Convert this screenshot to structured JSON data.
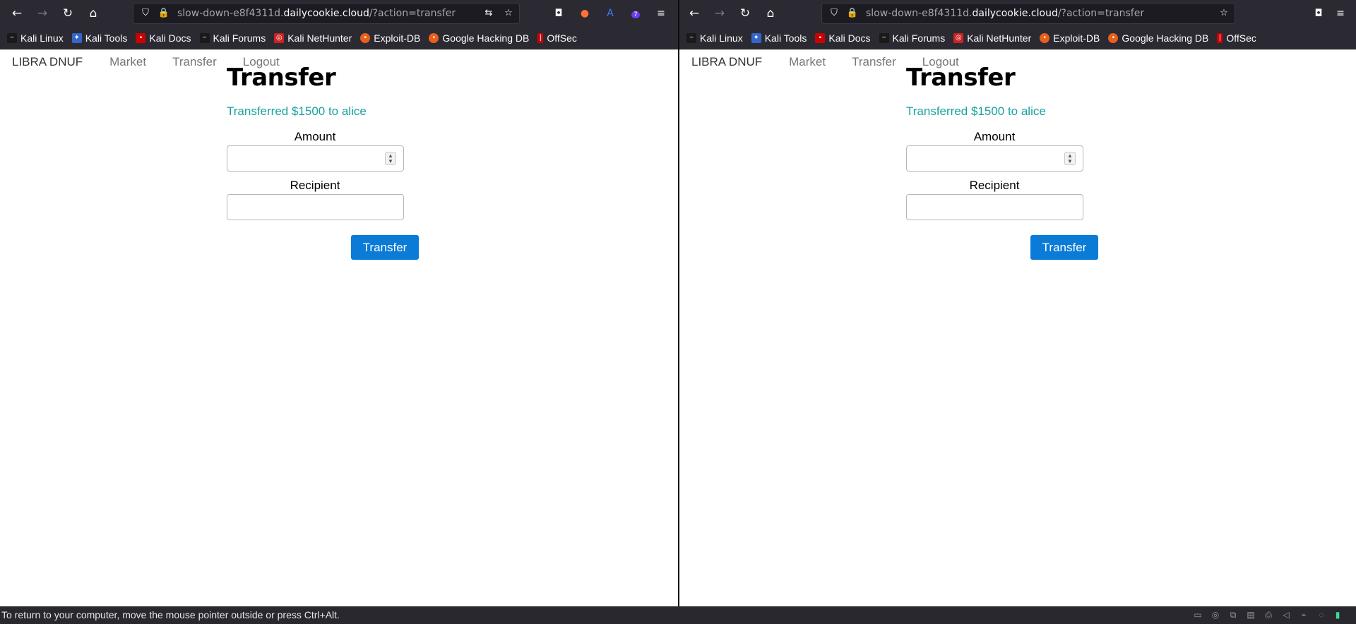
{
  "browser": {
    "url_prefix": "slow-down-e8f4311d.",
    "url_domain": "dailycookie.cloud",
    "url_suffix": "/?action=transfer",
    "back_icon": "←",
    "forward_icon": "→",
    "reload_icon": "↻",
    "home_icon": "⌂",
    "shield_icon": "⛉",
    "lock_icon": "🔒",
    "translate_icon": "⇆",
    "star_icon": "☆",
    "pocket_icon": "◘",
    "fox_icon": "●",
    "ext_icon": "A",
    "menu_icon": "≡",
    "extension_badge": "7"
  },
  "bookmarks": [
    {
      "label": "Kali Linux",
      "color": "#1a1a1a"
    },
    {
      "label": "Kali Tools",
      "color": "#3366cc"
    },
    {
      "label": "Kali Docs",
      "color": "#cc0000"
    },
    {
      "label": "Kali Forums",
      "color": "#1a1a1a"
    },
    {
      "label": "Kali NetHunter",
      "color": "#cc2222"
    },
    {
      "label": "Exploit-DB",
      "color": "#e8601a"
    },
    {
      "label": "Google Hacking DB",
      "color": "#e8601a"
    },
    {
      "label": "OffSec",
      "color": "#cc0000"
    }
  ],
  "site": {
    "brand": "LIBRA DNUF",
    "nav": [
      "Market",
      "Transfer",
      "Logout"
    ],
    "title": "Transfer",
    "message": "Transferred $1500 to alice",
    "amount_label": "Amount",
    "recipient_label": "Recipient",
    "amount_value": "",
    "recipient_value": "",
    "submit_label": "Transfer",
    "accent_color": "#0a7bd7",
    "success_color": "#17a2a0"
  },
  "status_bar": {
    "text": "To return to your computer, move the mouse pointer outside or press Ctrl+Alt."
  }
}
